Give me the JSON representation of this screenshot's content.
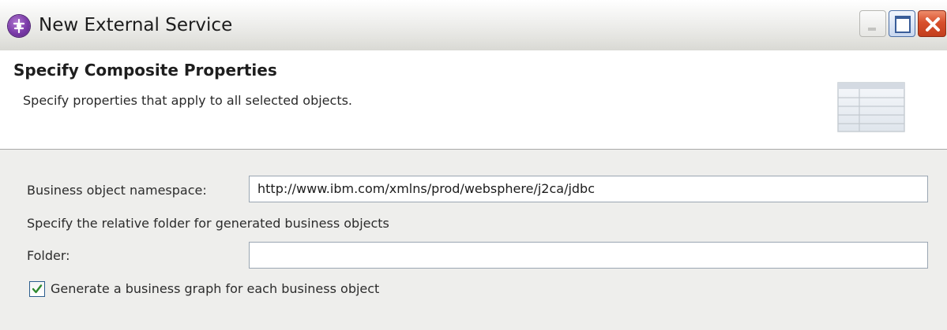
{
  "window": {
    "title": "New External Service",
    "icon": "external-service-globe-icon",
    "controls": {
      "minimize_icon": "minimize-icon",
      "maximize_icon": "maximize-icon",
      "close_icon": "close-icon"
    }
  },
  "header": {
    "title": "Specify Composite Properties",
    "description": "Specify properties that apply to all selected objects.",
    "icon": "table-icon"
  },
  "form": {
    "namespace_label": "Business object namespace:",
    "namespace_value": "http://www.ibm.com/xmlns/prod/websphere/j2ca/jdbc",
    "folder_hint": "Specify the relative folder for generated business objects",
    "folder_label": "Folder:",
    "folder_value": "",
    "business_graph_label": "Generate a business graph for each business object",
    "business_graph_checked": true
  },
  "colors": {
    "titlebar_top": "#ffffff",
    "titlebar_bottom": "#d9d9d4",
    "body_background": "#eeeeec",
    "close_button": "#d8502c",
    "checkmark": "#2f8a2f"
  }
}
